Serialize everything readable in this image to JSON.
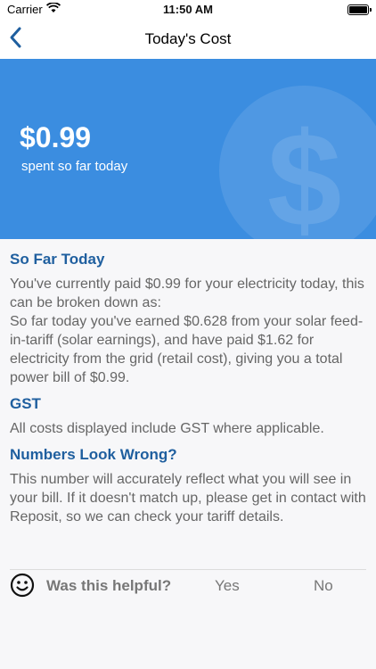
{
  "status_bar": {
    "carrier": "Carrier",
    "time": "11:50 AM"
  },
  "nav": {
    "title": "Today's Cost"
  },
  "hero": {
    "amount": "$0.99",
    "subtitle": "spent so far today"
  },
  "sections": [
    {
      "heading": "So Far Today",
      "paragraphs": [
        "You've currently paid $0.99 for your electricity today, this can be broken down as:",
        "So far today you've earned $0.628 from your solar feed-in-tariff (solar earnings), and have paid $1.62 for electricity from the grid (retail cost), giving you a total power bill of $0.99."
      ]
    },
    {
      "heading": "GST",
      "paragraphs": [
        "All costs displayed include GST where applicable."
      ]
    },
    {
      "heading": "Numbers Look Wrong?",
      "paragraphs": [
        "This number will accurately reflect what you will see in your bill. If it doesn't match up, please get in contact with Reposit, so we can check your tariff details."
      ]
    }
  ],
  "feedback": {
    "question": "Was this helpful?",
    "yes_label": "Yes",
    "no_label": "No"
  },
  "colors": {
    "hero_background": "#3b8de0",
    "heading": "#1f5f9f",
    "accent": "#1f5f9f"
  }
}
